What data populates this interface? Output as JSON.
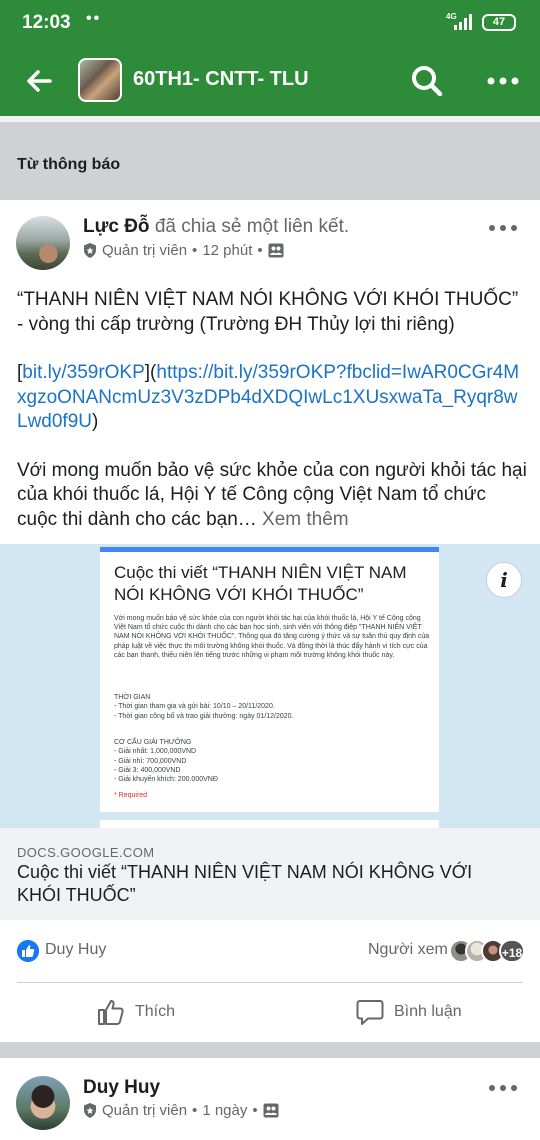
{
  "status_bar": {
    "time": "12:03",
    "dots": "••",
    "network": "4G",
    "battery": "47"
  },
  "toolbar": {
    "title": "60TH1- CNTT- TLU"
  },
  "section": {
    "label": "Từ thông báo"
  },
  "post1": {
    "author": "Lực Đỗ",
    "action_text": "đã chia sẻ một liên kết.",
    "role": "Quản trị viên",
    "time": "12 phút",
    "separator": "•",
    "body": {
      "line1": "“THANH NIÊN VIỆT NAM NÓI KHÔNG VỚI KHÓI THUỐC” - vòng thi cấp trường (Trường ĐH Thủy lợi thi riêng)",
      "bracket_open": "[",
      "short_link": "bit.ly/359rOKP",
      "bracket_mid": "](",
      "full_link": "https://bit.ly/359rOKP?fbclid=IwAR0CGr4MxgzoONANcmUz3V3zDPb4dXDQIwLc1XUsxwaTa_Ryqr8wLwd0f9U",
      "bracket_close": ")",
      "para2": "Với mong muốn bảo vệ sức khỏe của con người khỏi tác hại của khói thuốc lá, Hội Y tế Công cộng Việt Nam tổ chức cuộc thi dành cho các bạn…",
      "see_more": "Xem thêm"
    },
    "preview": {
      "form_title": "Cuộc thi viết “THANH NIÊN VIỆT NAM NÓI KHÔNG VỚI KHÓI THUỐC”",
      "form_desc": "Với mong muốn bảo vệ sức khỏe của con người khỏi tác hại của khói thuốc lá, Hội Y tế Công cộng Việt Nam tổ chức cuộc thi dành cho các bạn học sinh, sinh viên với thông điệp \"THANH NIÊN VIỆT NAM NÓI KHÔNG VỚI KHÓI THUỐC\". Thông qua đó tăng cường ý thức và sự tuân thủ quy định của pháp luật về việc thực thi môi trường không khói thuốc. Và đồng thời là thúc đẩy hành vi tích cực của các bạn thanh, thiếu niên lên tiếng trước những vi phạm môi trường không khói thuốc này.",
      "time_heading": "THỜI GIAN",
      "time_items": [
        "-    Thời gian tham gia và gửi bài: 10/10 – 20/11/2020.",
        "-    Thời gian công bố và trao giải thưởng: ngày 01/12/2020."
      ],
      "prize_heading": "CƠ CẤU GIẢI THƯỞNG",
      "prize_items": [
        "-    Giải nhất: 1,000,000VND",
        "-    Giải nhì: 700,000VND",
        "-    Giải 3: 400,000VND",
        "-    Giải khuyến khích: 200.000VNĐ"
      ],
      "required": "* Required",
      "info_glyph": "i",
      "domain": "DOCS.GOOGLE.COM",
      "title": "Cuộc thi viết “THANH NIÊN VIỆT NAM NÓI KHÔNG VỚI KHÓI THUỐC”"
    },
    "reactions": {
      "liker": "Duy Huy",
      "viewers_label": "Người xem",
      "viewers_count": "+18"
    },
    "actions": {
      "like": "Thích",
      "comment": "Bình luận"
    }
  },
  "post2": {
    "author": "Duy Huy",
    "role": "Quản trị viên",
    "time": "1 ngày",
    "separator": "•"
  },
  "colors": {
    "app_green": "#2e8b3a",
    "link_blue": "#1a73c8",
    "like_blue": "#1877f2",
    "form_blue": "#4285f4",
    "required_red": "#d93025"
  }
}
